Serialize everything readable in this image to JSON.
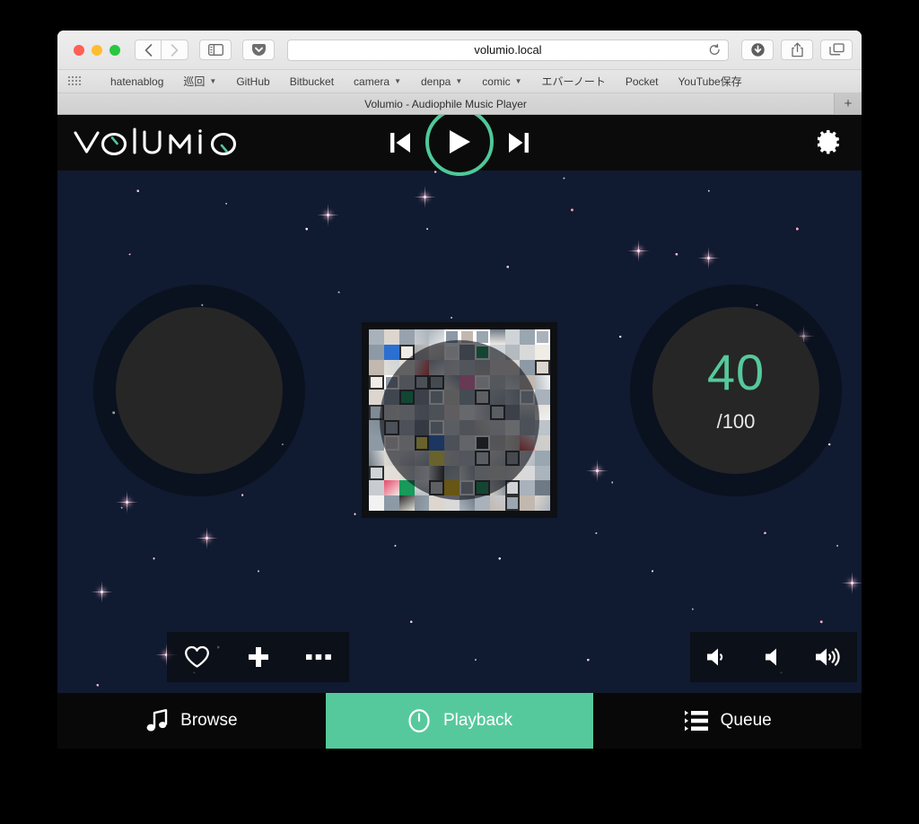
{
  "browser": {
    "url": "volumio.local",
    "tab_title": "Volumio - Audiophile Music Player",
    "new_tab_label": "+",
    "back_icon": "back-chevron-icon",
    "forward_icon": "forward-chevron-icon",
    "sidebar_icon": "sidebar-toggle-icon",
    "pocket_icon": "pocket-icon",
    "reload_icon": "reload-icon",
    "download_icon": "download-icon",
    "share_icon": "share-icon",
    "tabs_icon": "show-all-tabs-icon"
  },
  "bookmarks": {
    "apps_icon": "apps-grid-icon",
    "items": [
      {
        "label": "hatenablog",
        "has_menu": false
      },
      {
        "label": "巡回",
        "has_menu": true
      },
      {
        "label": "GitHub",
        "has_menu": false
      },
      {
        "label": "Bitbucket",
        "has_menu": false
      },
      {
        "label": "camera",
        "has_menu": true
      },
      {
        "label": "denpa",
        "has_menu": true
      },
      {
        "label": "comic",
        "has_menu": true
      },
      {
        "label": "エバーノート",
        "has_menu": false
      },
      {
        "label": "Pocket",
        "has_menu": false
      },
      {
        "label": "YouTube保存",
        "has_menu": false
      }
    ]
  },
  "app": {
    "brand": "VOLUMIO",
    "brand_accent_color": "#4fc89a",
    "accent_color": "#56c99c",
    "transport": {
      "previous_label": "Previous track",
      "play_label": "Play",
      "next_label": "Next track"
    },
    "settings_label": "Settings",
    "volume": {
      "value": "40",
      "max_label": "/100",
      "value_color": "#56c99c"
    },
    "track_actions": [
      {
        "name": "favorite",
        "label": "Add to favourites",
        "icon": "heart-icon"
      },
      {
        "name": "add",
        "label": "Add to playlist",
        "icon": "plus-icon"
      },
      {
        "name": "more",
        "label": "More options",
        "icon": "ellipsis-icon"
      }
    ],
    "volume_actions": [
      {
        "name": "volume-down",
        "label": "Volume down",
        "icon": "volume-down-icon"
      },
      {
        "name": "mute",
        "label": "Mute",
        "icon": "volume-mute-icon"
      },
      {
        "name": "volume-up",
        "label": "Volume up",
        "icon": "volume-up-icon"
      }
    ],
    "album_art_label": "Album art collage",
    "bottom_nav": [
      {
        "id": "browse",
        "label": "Browse",
        "icon": "music-note-icon",
        "active": false
      },
      {
        "id": "playback",
        "label": "Playback",
        "icon": "clock-icon",
        "active": true
      },
      {
        "id": "queue",
        "label": "Queue",
        "icon": "list-icon",
        "active": false
      }
    ]
  }
}
